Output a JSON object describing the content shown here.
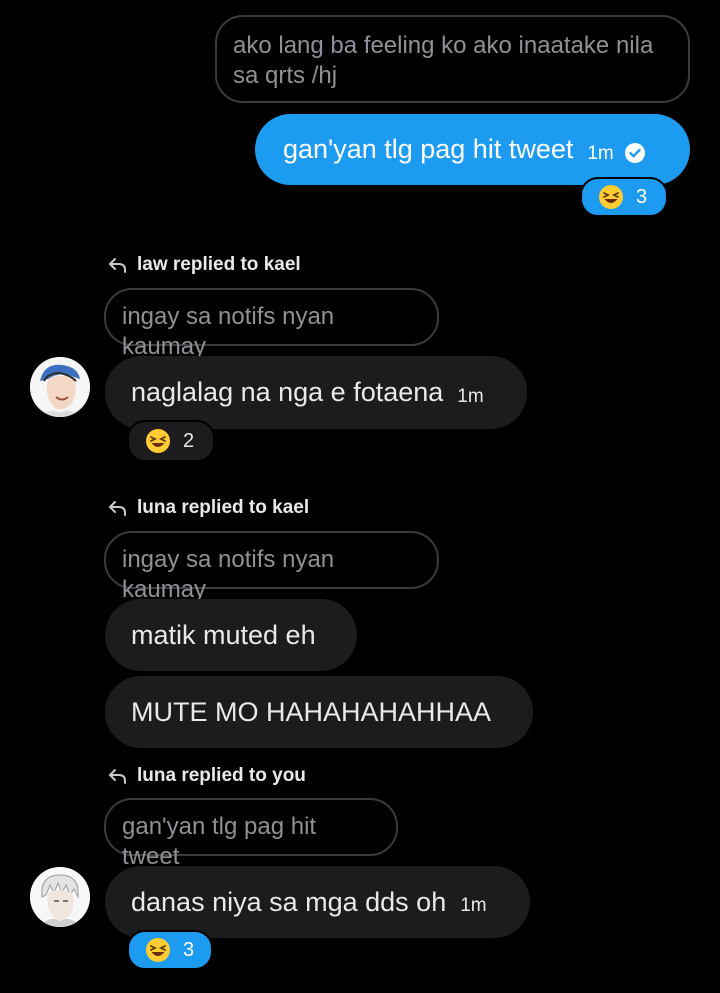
{
  "thread": {
    "my_quote": {
      "text": "ako lang ba feeling ko ako inaatake nila sa qrts /hj"
    },
    "my_message": {
      "text": "gan'yan tlg pag hit tweet",
      "time": "1m",
      "reaction": {
        "emoji": "grinning-squinting-face",
        "count": "3"
      }
    },
    "law_reply": {
      "label": "law replied to kael",
      "quote": "ingay sa notifs nyan kaumay",
      "message": {
        "text": "naglalag na nga e fotaena",
        "time": "1m"
      },
      "reaction": {
        "emoji": "grinning-squinting-face",
        "count": "2"
      }
    },
    "luna_reply_1": {
      "label": "luna replied to kael",
      "quote": "ingay sa notifs nyan kaumay",
      "messages": [
        {
          "text": "matik muted eh"
        },
        {
          "text": "MUTE MO HAHAHAHAHHAA"
        }
      ]
    },
    "luna_reply_2": {
      "label": "luna replied to you",
      "quote": "gan'yan tlg pag hit tweet",
      "message": {
        "text": "danas niya sa mga dds oh",
        "time": "1m"
      },
      "reaction": {
        "emoji": "grinning-squinting-face",
        "count": "3"
      }
    }
  },
  "colors": {
    "background": "#000000",
    "bubble": "#1c1c1f",
    "accent": "#1d9bf0",
    "quote_border": "#3a3b3f"
  }
}
